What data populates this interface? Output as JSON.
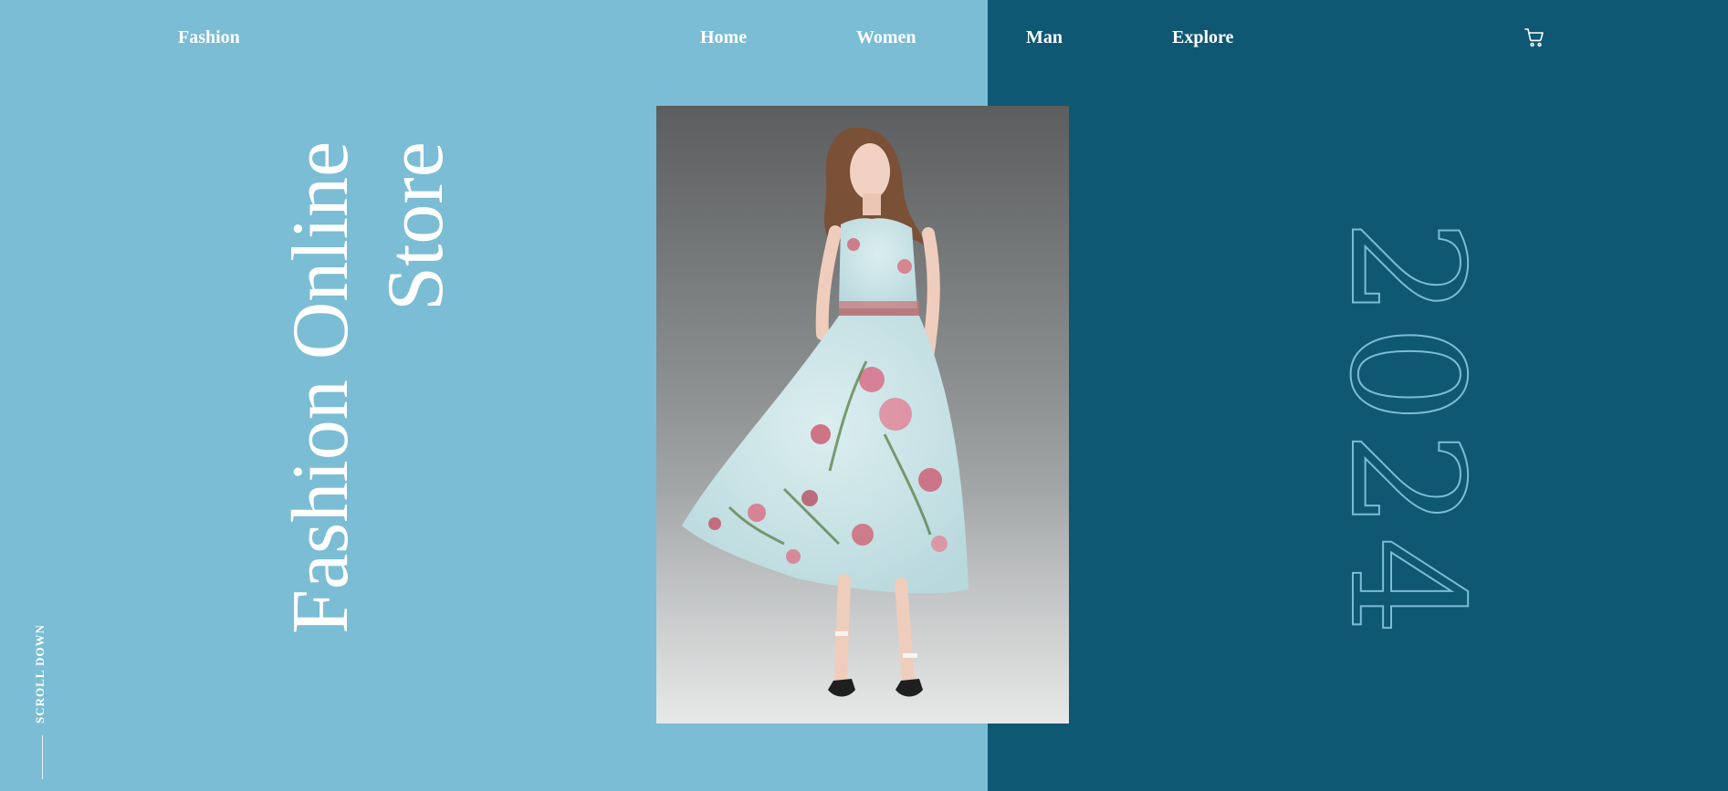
{
  "brand": {
    "logo": "Fashion"
  },
  "nav": [
    {
      "label": "Home"
    },
    {
      "label": "Women"
    },
    {
      "label": "Man"
    },
    {
      "label": "Explore"
    }
  ],
  "header": {
    "cart_icon": "shopping-cart-icon"
  },
  "hero": {
    "title_line1": "Fashion Online",
    "title_line2": "Store",
    "year": "2024",
    "image_alt": "model in floral dress"
  },
  "scroll": {
    "label": "SCROLL DOWN"
  },
  "colors": {
    "left_bg": "#7bbdd4",
    "right_bg": "#0f5874",
    "text": "#ffffff",
    "outline": "#7bbdd4"
  }
}
